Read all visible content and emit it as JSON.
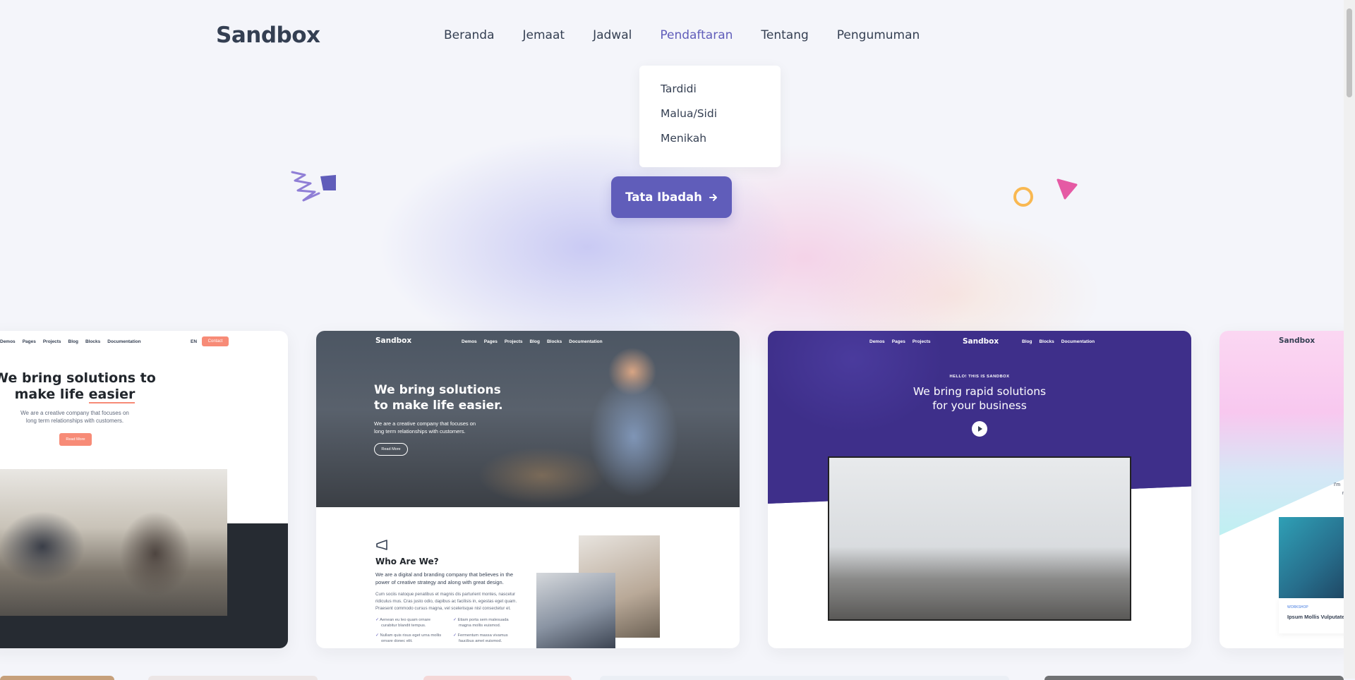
{
  "brand": {
    "logo": "Sandbox",
    "accent": "#605dba",
    "dark": "#343f52",
    "cta_color": "#f78b77"
  },
  "nav": {
    "items": [
      {
        "label": "Beranda"
      },
      {
        "label": "Jemaat"
      },
      {
        "label": "Jadwal"
      },
      {
        "label": "Pendaftaran",
        "active": true
      },
      {
        "label": "Tentang"
      },
      {
        "label": "Pengumuman"
      }
    ]
  },
  "dropdown": {
    "items": [
      "Tardidi",
      "Malua/Sidi",
      "Menikah"
    ]
  },
  "hero": {
    "cta_label": "Tata Ibadah",
    "cta_icon": "arrow-right-icon"
  },
  "cards": [
    {
      "nav": [
        "Demos",
        "Pages",
        "Projects",
        "Blog",
        "Blocks",
        "Documentation"
      ],
      "lang": "EN",
      "contact": "Contact",
      "headline_1": "We bring solutions to",
      "headline_2a": "make life ",
      "headline_2b": "easier",
      "text_1": "We are a creative company that focuses on",
      "text_2": "long term relationships with customers.",
      "button": "Read More"
    },
    {
      "logo": "Sandbox",
      "nav": [
        "Demos",
        "Pages",
        "Projects",
        "Blog",
        "Blocks",
        "Documentation"
      ],
      "headline_1": "We bring solutions",
      "headline_2": "to make life easier.",
      "text_1": "We are a creative company that focuses on",
      "text_2": "long term relationships with customers.",
      "button": "Read More",
      "about_title": "Who Are We?",
      "about_lead_1": "We are a digital and branding company that believes in the",
      "about_lead_2": "power of creative strategy and along with great design.",
      "about_body_1": "Cum sociis natoque penatibus et magnis dis parturient montes, nascetur",
      "about_body_2": "ridiculus mus. Cras justo odio, dapibus ac facilisis in, egestas eget quam.",
      "about_body_3": "Praesent commodo cursus magna, vel scelerisque nisl consectetur et.",
      "bullets": [
        [
          "Aenean eu leo quam ornare",
          "curabitur blandit tempus."
        ],
        [
          "Etiam porta sem malesuada",
          "magna mollis euismod."
        ],
        [
          "Nullam quis risus eget urna mollis",
          "ornare donec elit."
        ],
        [
          "Fermentum massa vivamus",
          "faucibus amet euismod."
        ]
      ]
    },
    {
      "logo": "Sandbox",
      "nav_left": [
        "Demos",
        "Pages",
        "Projects"
      ],
      "nav_right": [
        "Blog",
        "Blocks",
        "Documentation"
      ],
      "eyebrow": "HELLO! THIS IS SANDBOX",
      "headline_1": "We bring rapid solutions",
      "headline_2": "for your business"
    },
    {
      "logo": "Sandbox",
      "side_text_1": "I'm",
      "side_text_2": "m",
      "tag": "WORKSHOP",
      "caption": "Ipsum Mollis Vulputate"
    }
  ]
}
